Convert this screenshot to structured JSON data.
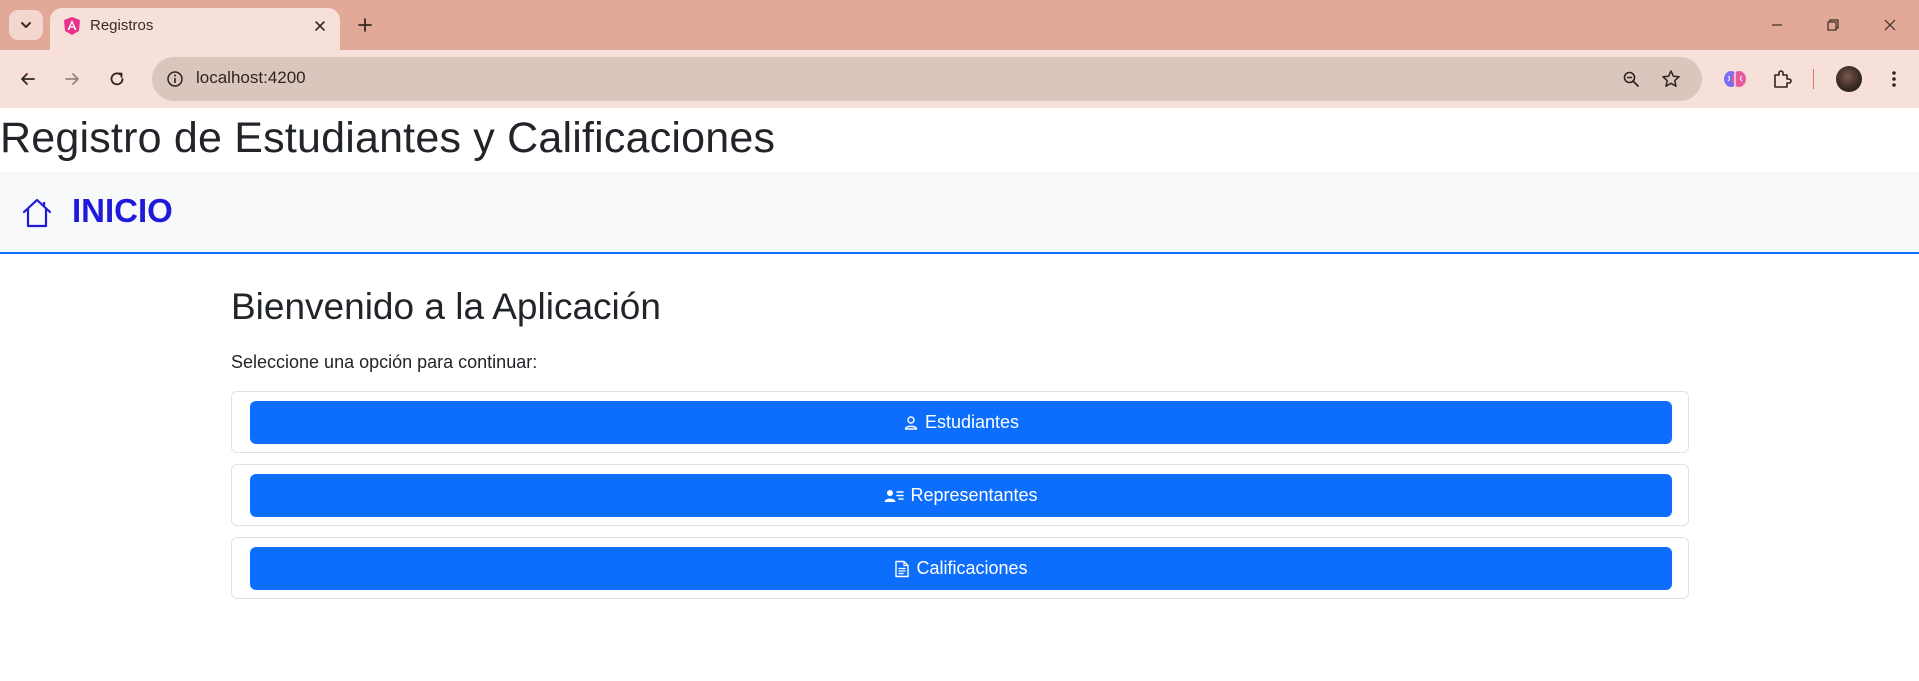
{
  "browser": {
    "tab_title": "Registros",
    "url": "localhost:4200"
  },
  "app": {
    "title": "Registro de Estudiantes y Calificaciones",
    "nav_home_label": "INICIO",
    "accent_color": "#0d6efd",
    "home_link_color": "#1f19d9"
  },
  "main": {
    "heading": "Bienvenido a la Aplicación",
    "subtitle": "Seleccione una opción para continuar:",
    "options": [
      {
        "label": "Estudiantes",
        "icon": "person-icon"
      },
      {
        "label": "Representantes",
        "icon": "person-lines-icon"
      },
      {
        "label": "Calificaciones",
        "icon": "file-text-icon"
      }
    ]
  }
}
